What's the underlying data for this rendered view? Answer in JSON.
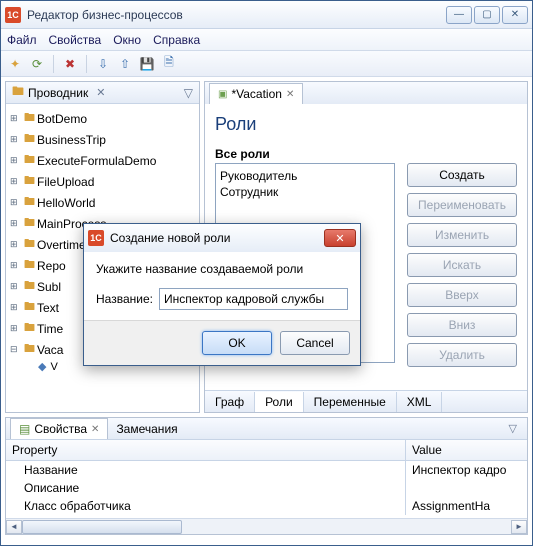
{
  "window": {
    "title": "Редактор бизнес-процессов"
  },
  "menu": {
    "file": "Файл",
    "properties": "Свойства",
    "window": "Окно",
    "help": "Справка"
  },
  "explorer": {
    "title": "Проводник",
    "items": [
      "BotDemo",
      "BusinessTrip",
      "ExecuteFormulaDemo",
      "FileUpload",
      "HelloWorld",
      "MainProcess",
      "OvertimeWork",
      "Repo",
      "Subl",
      "Text",
      "Time",
      "Vaca"
    ],
    "child": "V"
  },
  "editor": {
    "tab": "*Vacation",
    "heading": "Роли",
    "all_roles_label": "Все роли",
    "roles": [
      "Руководитель",
      "Сотрудник"
    ],
    "buttons": {
      "create": "Создать",
      "rename": "Переименовать",
      "edit": "Изменить",
      "search": "Искать",
      "up": "Вверх",
      "down": "Вниз",
      "delete": "Удалить"
    },
    "tabs": {
      "graph": "Граф",
      "roles": "Роли",
      "vars": "Переменные",
      "xml": "XML"
    }
  },
  "properties": {
    "tab_props": "Свойства",
    "tab_notes": "Замечания",
    "col_property": "Property",
    "col_value": "Value",
    "rows": [
      {
        "name": "Название",
        "value": "Инспектор кадро"
      },
      {
        "name": "Описание",
        "value": ""
      },
      {
        "name": "Класс обработчика",
        "value": "AssignmentHa"
      }
    ]
  },
  "dialog": {
    "title": "Создание новой роли",
    "prompt": "Укажите название создаваемой роли",
    "field_label": "Название:",
    "value": "Инспектор кадровой службы",
    "ok": "OK",
    "cancel": "Cancel"
  }
}
